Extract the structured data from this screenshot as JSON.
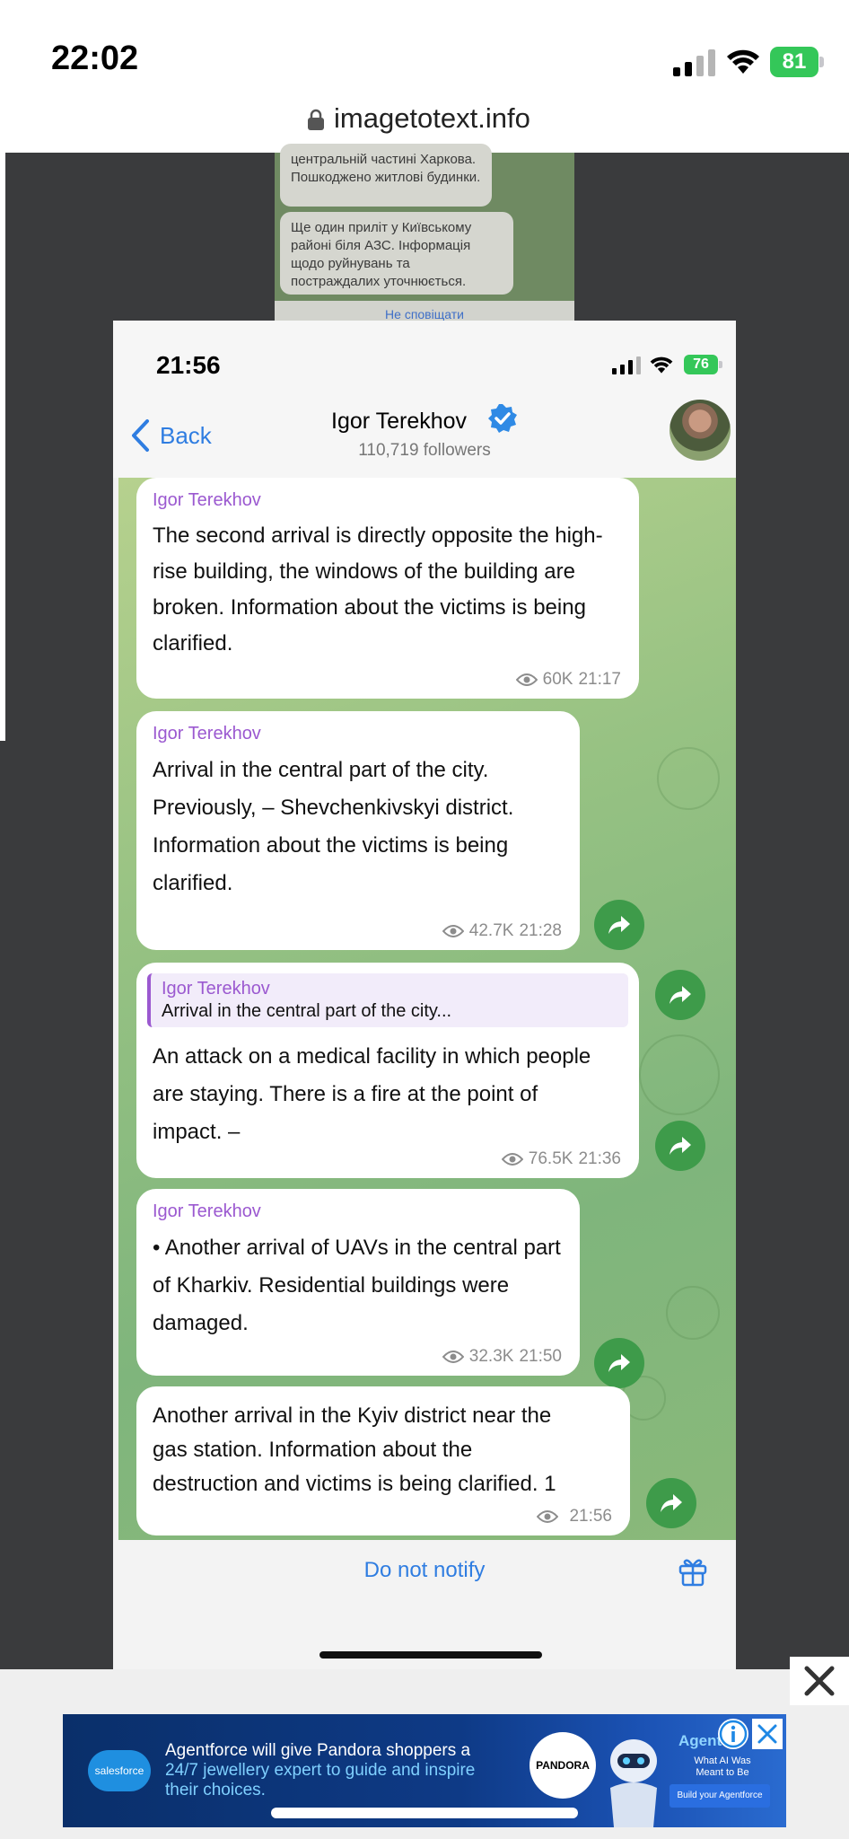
{
  "device_status": {
    "time": "22:02",
    "battery": "81"
  },
  "browser": {
    "url": "imagetotext.info"
  },
  "background_page": {
    "bubble1": "центральній частині Харкова. Пошкоджено житлові будинки.",
    "bubble2": "Ще один приліт у Київському районі біля АЗС. Інформація щодо руйнувань та постраждалих уточнюється.",
    "notify": "Не сповіщати"
  },
  "telegram": {
    "status": {
      "time": "21:56",
      "battery": "76"
    },
    "header": {
      "back_label": "Back",
      "channel_name": "Igor Terekhov",
      "followers": "110,719 followers"
    },
    "messages": [
      {
        "author": "Igor Terekhov",
        "text": "The second arrival is directly opposite the high-rise building, the windows of the building are broken. Information about the victims is being clarified.",
        "views": "60K",
        "time": "21:17"
      },
      {
        "author": "Igor Terekhov",
        "text": "Arrival in the central part of the city. Previously, – Shevchenkivskyi district. Information about the victims is being clarified.",
        "views": "42.7K",
        "time": "21:28"
      },
      {
        "reply_author": "Igor Terekhov",
        "reply_text": "Arrival in the central part of the city...",
        "text": "An attack on a medical facility in which people are staying. There is a fire at the point of impact. –",
        "views": "76.5K",
        "time": "21:36"
      },
      {
        "author": "Igor Terekhov",
        "text": "• Another arrival of UAVs in the central part of Kharkiv. Residential buildings were damaged.",
        "views": "32.3K",
        "time": "21:50"
      },
      {
        "text": "Another arrival in the Kyiv district near the gas station. Information about the destruction and victims is being clarified. 1",
        "views": "",
        "time": "21:56"
      }
    ],
    "bottom": {
      "notify_label": "Do not notify"
    }
  },
  "ad": {
    "brand_logo": "salesforce",
    "line1": "Agentforce will give Pandora shoppers a",
    "line2": "24/7 jewellery expert to guide and inspire",
    "line3": "their choices.",
    "partner": "PANDORA",
    "agent_title": "Agent",
    "agent_sub": "What AI Was Meant to Be",
    "cta": "Build your Agentforce"
  },
  "colors": {
    "accent_blue": "#2f7de1",
    "author_purple": "#9b59d0",
    "share_green": "#3e9b4a",
    "battery_green": "#34c759"
  },
  "icons": [
    "lock-icon",
    "signal-icon",
    "wifi-icon",
    "chevron-left-icon",
    "verified-icon",
    "eye-icon",
    "share-icon",
    "gift-icon",
    "close-icon",
    "info-icon"
  ]
}
